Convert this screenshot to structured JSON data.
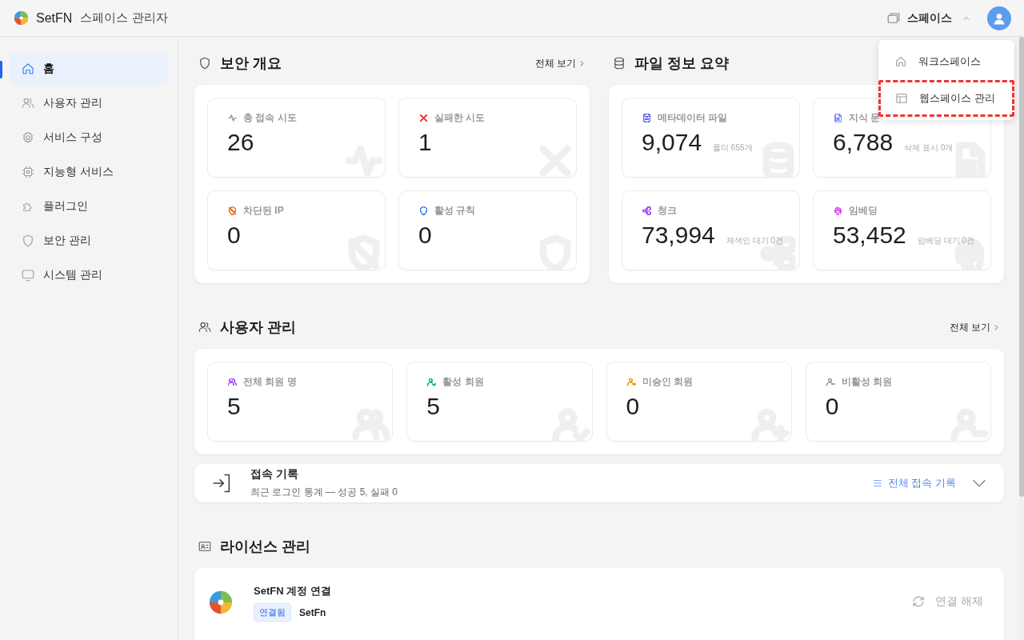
{
  "header": {
    "brand": "SetFN",
    "subtitle": "스페이스 관리자",
    "space_menu": "스페이스"
  },
  "space_dropdown": [
    {
      "label": "워크스페이스",
      "highlighted": false
    },
    {
      "label": "웹스페이스 관리",
      "highlighted": true
    }
  ],
  "sidebar": {
    "items": [
      {
        "label": "홈",
        "selected": true
      },
      {
        "label": "사용자 관리",
        "selected": false
      },
      {
        "label": "서비스 구성",
        "selected": false
      },
      {
        "label": "지능형 서비스",
        "selected": false
      },
      {
        "label": "플러그인",
        "selected": false
      },
      {
        "label": "보안 관리",
        "selected": false
      },
      {
        "label": "시스템 관리",
        "selected": false
      }
    ]
  },
  "security_overview": {
    "title": "보안 개요",
    "link": "전체 보기",
    "cards": [
      {
        "label": "총 접속 시도",
        "value": "26",
        "color": "#9ca3af"
      },
      {
        "label": "실패한 시도",
        "value": "1",
        "color": "#ef4444"
      },
      {
        "label": "차단된 IP",
        "value": "0",
        "color": "#f97316"
      },
      {
        "label": "활성 규칙",
        "value": "0",
        "color": "#3b82f6"
      }
    ]
  },
  "file_summary": {
    "title": "파일 정보 요약",
    "cards": [
      {
        "label": "메타데이터 파일",
        "value": "9,074",
        "note": "폴더 655개",
        "color": "#6366f1"
      },
      {
        "label": "지식 문",
        "value": "6,788",
        "note": "삭제 표시 0개",
        "color": "#818cf8"
      },
      {
        "label": "청크",
        "value": "73,994",
        "note": "재색인 대기 0건",
        "color": "#a855f7"
      },
      {
        "label": "임베딩",
        "value": "53,452",
        "note": "임베딩 대기 0건",
        "color": "#d946ef"
      }
    ]
  },
  "user_management": {
    "title": "사용자 관리",
    "link": "전체 보기",
    "cards": [
      {
        "label": "전체 회원 명",
        "value": "5",
        "color": "#a855f7"
      },
      {
        "label": "활성 회원",
        "value": "5",
        "color": "#10b981"
      },
      {
        "label": "미승인 회원",
        "value": "0",
        "color": "#f59e0b"
      },
      {
        "label": "비활성 회원",
        "value": "0",
        "color": "#9ca3af"
      }
    ]
  },
  "access_log": {
    "title": "접속 기록",
    "subtitle": "최근 로그인 통계 — 성공 5, 실패 0",
    "link": "전체 접속 기록",
    "expanded": false
  },
  "license": {
    "title": "라이선스 관리",
    "account_title": "SetFN 계정 연결",
    "status": "연결됨",
    "account_name": "SetFn",
    "action": "연결 해제"
  }
}
